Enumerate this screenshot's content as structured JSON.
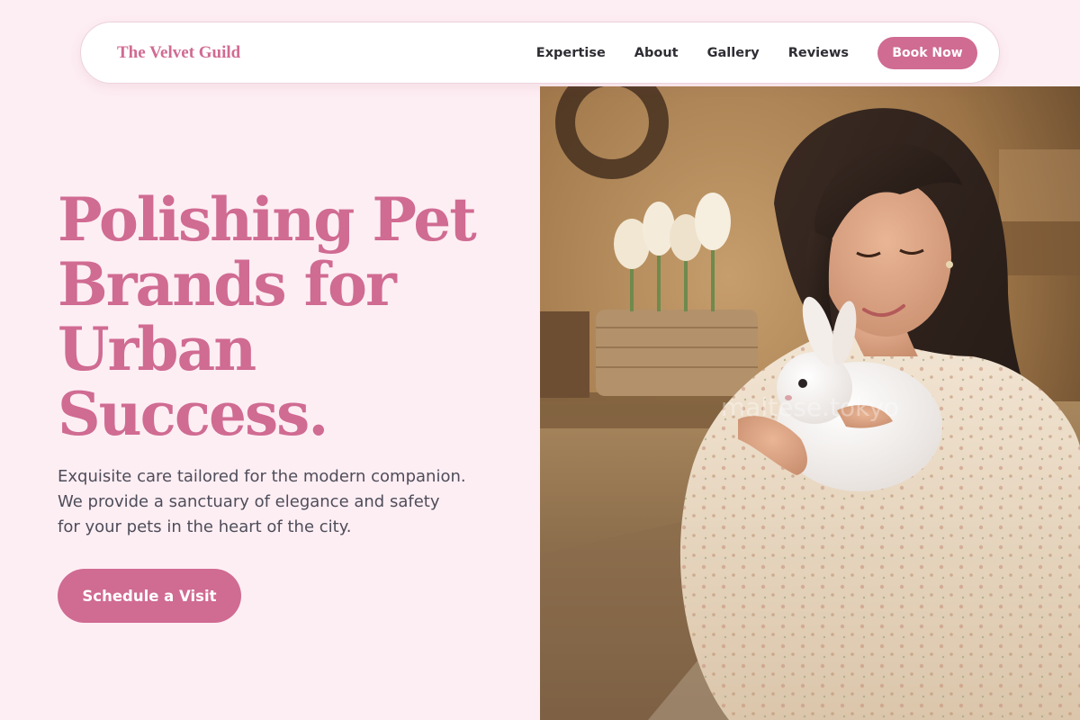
{
  "nav": {
    "brand": "The Velvet Guild",
    "links": [
      "Expertise",
      "About",
      "Gallery",
      "Reviews"
    ],
    "cta_label": "Book Now"
  },
  "hero": {
    "title_lines": [
      "Polishing Pet",
      "Brands for",
      "Urban",
      "Success."
    ],
    "description_lines": [
      "Exquisite care tailored for the modern companion.",
      "We provide a sanctuary of elegance and safety",
      "for your pets in the heart of the city."
    ],
    "cta_label": "Schedule a Visit",
    "image_watermark": "maltese.tokyo"
  },
  "colors": {
    "accent": "#d06b92",
    "background": "#fdeef3",
    "text_dark": "#2d2d33",
    "text_body": "#4e4d5a"
  },
  "icons": {
    "hero_photo": "woman-holding-white-rabbit-photo"
  }
}
